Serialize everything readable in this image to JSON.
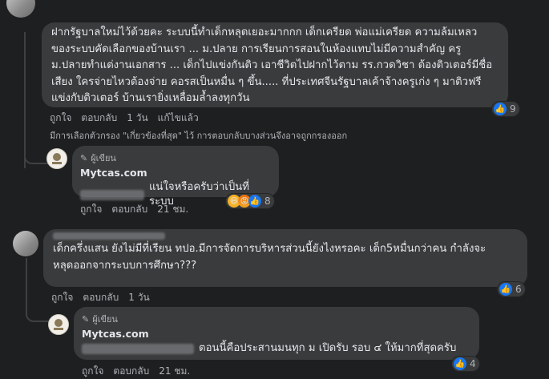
{
  "comment1": {
    "text": "ฝากรัฐบาลใหม่ไว้ด้วยคะ ระบบนี้ทำเด็กหลุดเยอะมากกก เด็กเครียด พ่อแม่เครียด ความล้มเหลว\nของระบบคัดเลือกของบ้านเรา ... ม.ปลาย การเรียนการสอนในห้องแทบไม่มีความสำคัญ ครู\nม.ปลายทำแต่งานเอกสาร ... เด็กไปแข่งกันติว เอาชีวิตไปฝากไว้ตาม รร.กวดวิชา ต้องติวเตอร์มีชื่อ\nเสียง ใครจ่ายไหวต้องจ่าย คอรสเป็นหมื่น ๆ ขึ้น..... ที่ประเทศจีนรัฐบาลเค้าจ้างครูเก่ง ๆ มาติวฟรี\nแข่งกับติวเตอร์ บ้านเรายิ่งเหลื่อมล้ำลงทุกวัน",
    "like": "ถูกใจ",
    "reply": "ตอบกลับ",
    "time": "1 วัน",
    "edited": "แก้ไขแล้ว",
    "reaction_count": "9",
    "reaction_icon": "like-icon",
    "notice": "มีการเลือกตัวกรอง \"เกี่ยวข้องที่สุด\" ไว้ การตอบกลับบางส่วนจึงอาจถูกกรองออก"
  },
  "reply1": {
    "badge": "ผู้เขียน",
    "name": "Mytcas.com",
    "text": "แน่ใจหรือครับว่าเป็นที่ระบบ",
    "like": "ถูกใจ",
    "reply": "ตอบกลับ",
    "time": "21 ชม.",
    "reaction_count": "8",
    "reaction_icons": [
      "haha-icon",
      "angry-icon",
      "like-icon"
    ]
  },
  "comment2": {
    "text": "เด็กครึ่งแสน ยังไม่มีที่เรียน ทปอ.มีการจัดการบริหารส่วนนี้ยังไงหรอคะ เด็ก5หมื่นกว่าคน กำลังจะ\nหลุดออกจากระบบการศึกษา???",
    "like": "ถูกใจ",
    "reply": "ตอบกลับ",
    "time": "1 วัน",
    "reaction_count": "6",
    "reaction_icon": "like-icon"
  },
  "reply2": {
    "badge": "ผู้เขียน",
    "name": "Mytcas.com",
    "text": "ตอนนี้คือประสานมนทุก ม เปิดรับ รอบ ๔ ให้มากที่สุดครับ",
    "like": "ถูกใจ",
    "reply": "ตอบกลับ",
    "time": "21 ชม.",
    "reaction_count": "4",
    "reaction_icon": "like-icon"
  },
  "colors": {
    "background": "#1e1f20",
    "bubble": "#3a3b3c",
    "text": "#e4e6eb",
    "muted": "#b0b3b8",
    "like_blue": "#1877f2"
  }
}
